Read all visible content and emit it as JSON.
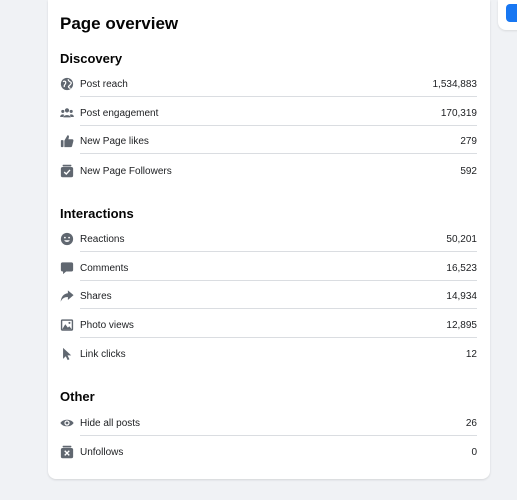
{
  "title": "Page overview",
  "colors": {
    "background": "#f0f2f5",
    "card": "#ffffff",
    "icon": "#606770",
    "divider": "#dadde1",
    "accent": "#1877f2"
  },
  "sections": [
    {
      "heading": "Discovery",
      "rows": [
        {
          "icon": "globe-icon",
          "label": "Post reach",
          "value": "1,534,883"
        },
        {
          "icon": "people-icon",
          "label": "Post engagement",
          "value": "170,319"
        },
        {
          "icon": "thumbs-up-icon",
          "label": "New Page likes",
          "value": "279"
        },
        {
          "icon": "followers-icon",
          "label": "New Page Followers",
          "value": "592"
        }
      ]
    },
    {
      "heading": "Interactions",
      "rows": [
        {
          "icon": "smiley-icon",
          "label": "Reactions",
          "value": "50,201"
        },
        {
          "icon": "comment-icon",
          "label": "Comments",
          "value": "16,523"
        },
        {
          "icon": "share-icon",
          "label": "Shares",
          "value": "14,934"
        },
        {
          "icon": "photo-icon",
          "label": "Photo views",
          "value": "12,895"
        },
        {
          "icon": "cursor-icon",
          "label": "Link clicks",
          "value": "12"
        }
      ]
    },
    {
      "heading": "Other",
      "rows": [
        {
          "icon": "eye-icon",
          "label": "Hide all posts",
          "value": "26"
        },
        {
          "icon": "unfollow-icon",
          "label": "Unfollows",
          "value": "0"
        }
      ]
    }
  ]
}
